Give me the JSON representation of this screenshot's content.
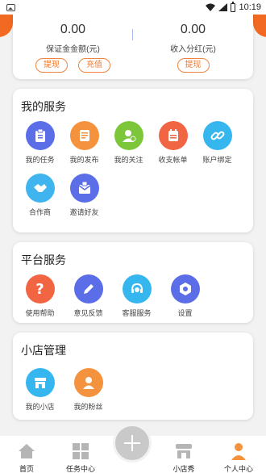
{
  "status_bar": {
    "time": "10:19"
  },
  "wallet": {
    "deposit": {
      "amount": "0.00",
      "label": "保证金金额(元)",
      "withdraw": "提现",
      "recharge": "充值"
    },
    "income": {
      "amount": "0.00",
      "label": "收入分红(元)",
      "withdraw": "提现"
    }
  },
  "my_services": {
    "title": "我的服务",
    "items": [
      {
        "label": "我的任务",
        "icon": "task-clipboard-icon",
        "color": "#5b6ee8"
      },
      {
        "label": "我的发布",
        "icon": "publish-document-icon",
        "color": "#f5923e"
      },
      {
        "label": "我的关注",
        "icon": "follow-person-icon",
        "color": "#7cc63a"
      },
      {
        "label": "收支帐单",
        "icon": "bill-icon",
        "color": "#f26542"
      },
      {
        "label": "账户绑定",
        "icon": "link-icon",
        "color": "#35b6ef"
      },
      {
        "label": "合作商",
        "icon": "handshake-icon",
        "color": "#3fb4ee"
      },
      {
        "label": "邀请好友",
        "icon": "invite-envelope-icon",
        "color": "#5b6ee8"
      }
    ]
  },
  "platform_services": {
    "title": "平台服务",
    "items": [
      {
        "label": "使用帮助",
        "icon": "help-question-icon",
        "color": "#f26542"
      },
      {
        "label": "意见反馈",
        "icon": "feedback-pencil-icon",
        "color": "#5b6ee8"
      },
      {
        "label": "客服服务",
        "icon": "customer-service-headset-icon",
        "color": "#35b6ef"
      },
      {
        "label": "设置",
        "icon": "settings-gear-icon",
        "color": "#5b6ee8"
      }
    ]
  },
  "shop_management": {
    "title": "小店管理",
    "items": [
      {
        "label": "我的小店",
        "icon": "shop-store-icon",
        "color": "#35b6ef"
      },
      {
        "label": "我的粉丝",
        "icon": "fans-person-icon",
        "color": "#f5923e"
      }
    ]
  },
  "bottom_nav": {
    "items": [
      {
        "label": "首页",
        "icon": "home-icon",
        "active": false
      },
      {
        "label": "任务中心",
        "icon": "task-grid-icon",
        "active": false
      },
      {
        "label": "小店秀",
        "icon": "shop-icon",
        "active": false
      },
      {
        "label": "个人中心",
        "icon": "person-icon",
        "active": true
      }
    ],
    "add_button_icon": "plus-icon",
    "inactive_color": "#b5b5b5",
    "active_color": "#f5923e"
  }
}
